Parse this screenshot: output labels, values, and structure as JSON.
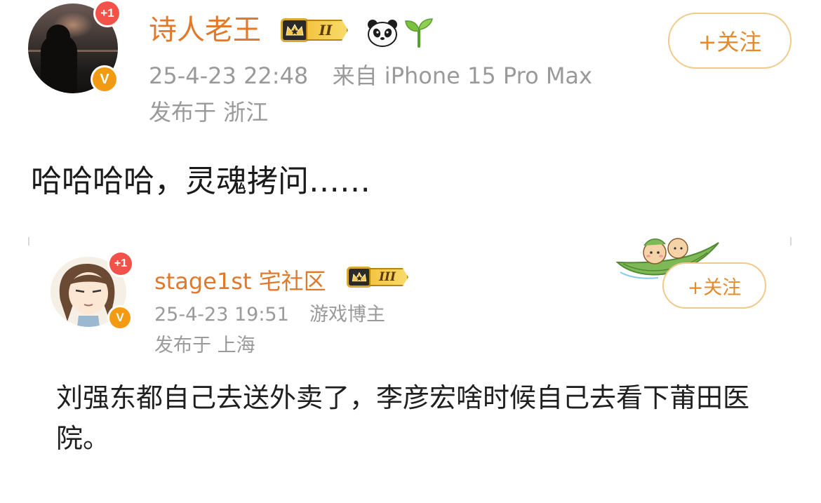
{
  "main_post": {
    "avatar_badge": "+1",
    "verified_badge": "V",
    "username": "诗人老王",
    "level": "II",
    "emoji_icons": [
      "panda-icon",
      "sprout-icon"
    ],
    "time": "25-4-23 22:48",
    "source": "来自 iPhone 15 Pro Max",
    "location": "发布于 浙江",
    "follow_label": "+关注",
    "text": "哈哈哈哈，灵魂拷问……"
  },
  "repost": {
    "avatar_badge": "+1",
    "verified_badge": "V",
    "username": "stage1st 宅社区",
    "level": "III",
    "time": "25-4-23 19:51",
    "tag": "游戏博主",
    "location": "发布于 上海",
    "follow_label": "+关注",
    "text": "刘强东都自己去送外卖了，李彦宏啥时候自己去看下莆田医院。"
  },
  "colors": {
    "username": "#e0792c",
    "meta": "#9a9a9a",
    "follow_border": "#f1c98a",
    "badge_red": "#f2524a",
    "badge_orange": "#f39a13"
  }
}
